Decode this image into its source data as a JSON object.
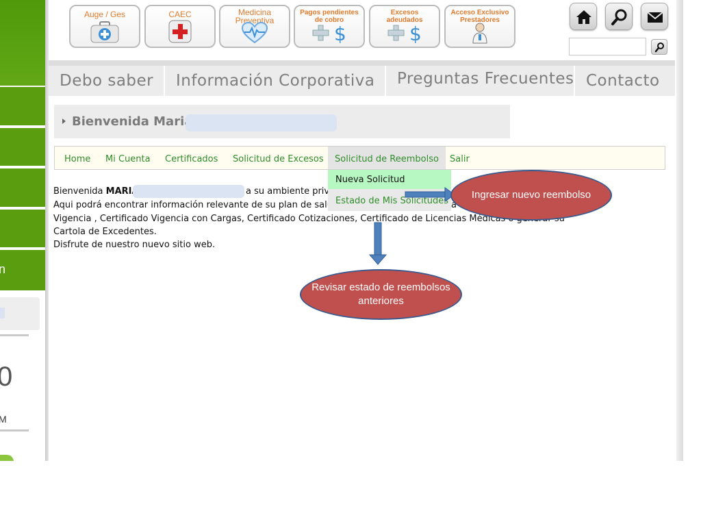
{
  "quick_links": [
    {
      "label": "Auge / Ges",
      "icon": "medical-kit-icon"
    },
    {
      "label": "CAEC",
      "icon": "red-cross-icon"
    },
    {
      "label": "Medicina\nPreventiva",
      "icon": "heart-monitor-icon"
    },
    {
      "label": "Pagos pendientes\nde cobro",
      "icon": "plus-dollar-icon"
    },
    {
      "label": "Excesos\nadeudados",
      "icon": "plus-dollar-icon"
    },
    {
      "label": "Acceso Exclusivo\nPrestadores",
      "icon": "doctor-icon"
    }
  ],
  "utility": {
    "home": "home-icon",
    "search": "magnifier-icon",
    "mail": "envelope-icon"
  },
  "search": {
    "value": "",
    "placeholder": ""
  },
  "main_nav": [
    {
      "label": "Debo saber"
    },
    {
      "label": "Información Corporativa"
    },
    {
      "label": "Preguntas Frecuentes"
    },
    {
      "label": "Contacto"
    }
  ],
  "welcome": {
    "title": "Bienvenida Maria"
  },
  "sub_nav": [
    {
      "label": "Home"
    },
    {
      "label": "Mi Cuenta"
    },
    {
      "label": "Certificados"
    },
    {
      "label": "Solicitud de Excesos"
    },
    {
      "label": "Solicitud de Reembolso"
    },
    {
      "label": "Salir"
    }
  ],
  "dropdown": [
    {
      "label": "Nueva Solicitud"
    },
    {
      "label": "Estado de Mis Solicitudes"
    }
  ],
  "body": {
    "line1_prefix": "Bienvenida ",
    "line1_name": "MARIA",
    "line1_suffix": "a su ambiente priva",
    "line2": "Aqui podrá encontrar información relevante de su plan de salud",
    "line2_tail": "a",
    "line3": "Vigencia , Certificado Vigencia con Cargas, Certificado Cotizaciones, Certificado de Licencias Médicas o generar su",
    "line4": "Cartola de Excedentes.",
    "line5": "Disfrute de nuestro nuevo sitio web."
  },
  "annotations": {
    "ingresar": "Ingresar nuevo reembolso",
    "revisar": "Revisar estado de reembolsos anteriores"
  },
  "left_panel": {
    "letter": "n",
    "big_text": "0",
    "small_text": "M"
  },
  "colors": {
    "green": "#5a9e0f",
    "link_green": "#2f8d2a",
    "orange": "#e07a2b",
    "bubble_red": "#c0504d",
    "arrow_blue": "#4f81bd"
  }
}
